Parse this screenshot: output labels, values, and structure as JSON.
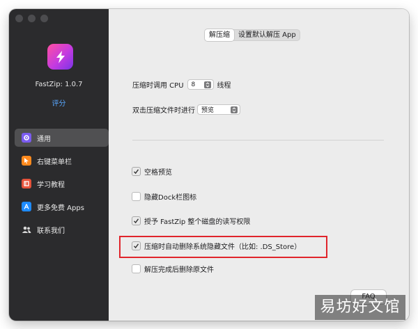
{
  "app": {
    "name_version": "FastZip: 1.0.7",
    "rate_link": "评分"
  },
  "sidebar": {
    "items": [
      {
        "label": "通用",
        "icon": "gear-icon",
        "active": true,
        "icon_color": "#7b5cf0"
      },
      {
        "label": "右键菜单栏",
        "icon": "cursor-icon",
        "active": false,
        "icon_color": "#ff8a1e"
      },
      {
        "label": "学习教程",
        "icon": "book-icon",
        "active": false,
        "icon_color": "#e5533b"
      },
      {
        "label": "更多免费 Apps",
        "icon": "app-store-icon",
        "active": false,
        "icon_color": "#1e8bff"
      },
      {
        "label": "联系我们",
        "icon": "people-icon",
        "active": false,
        "icon_color": "#d8d8d8"
      }
    ]
  },
  "tabs": [
    {
      "label": "解压缩",
      "active": true
    },
    {
      "label": "设置默认解压 App",
      "active": false
    }
  ],
  "settings": {
    "cpu_prefix": "压缩时调用 CPU",
    "cpu_value": "8",
    "cpu_suffix": "线程",
    "dblclick_label": "双击压缩文件时进行",
    "dblclick_value": "预览"
  },
  "options": [
    {
      "label": "空格预览",
      "checked": true
    },
    {
      "label": "隐藏Dock栏图标",
      "checked": false
    },
    {
      "label": "授予 FastZip 整个磁盘的读写权限",
      "checked": true
    },
    {
      "label": "压缩时自动删除系统隐藏文件（比如: .DS_Store）",
      "checked": true
    },
    {
      "label": "解压完成后删除原文件",
      "checked": false
    }
  ],
  "faq_label": "FAQ",
  "watermark_text": "易坊好文馆",
  "colors": {
    "highlight": "#e0242b",
    "link": "#58a7ff"
  }
}
